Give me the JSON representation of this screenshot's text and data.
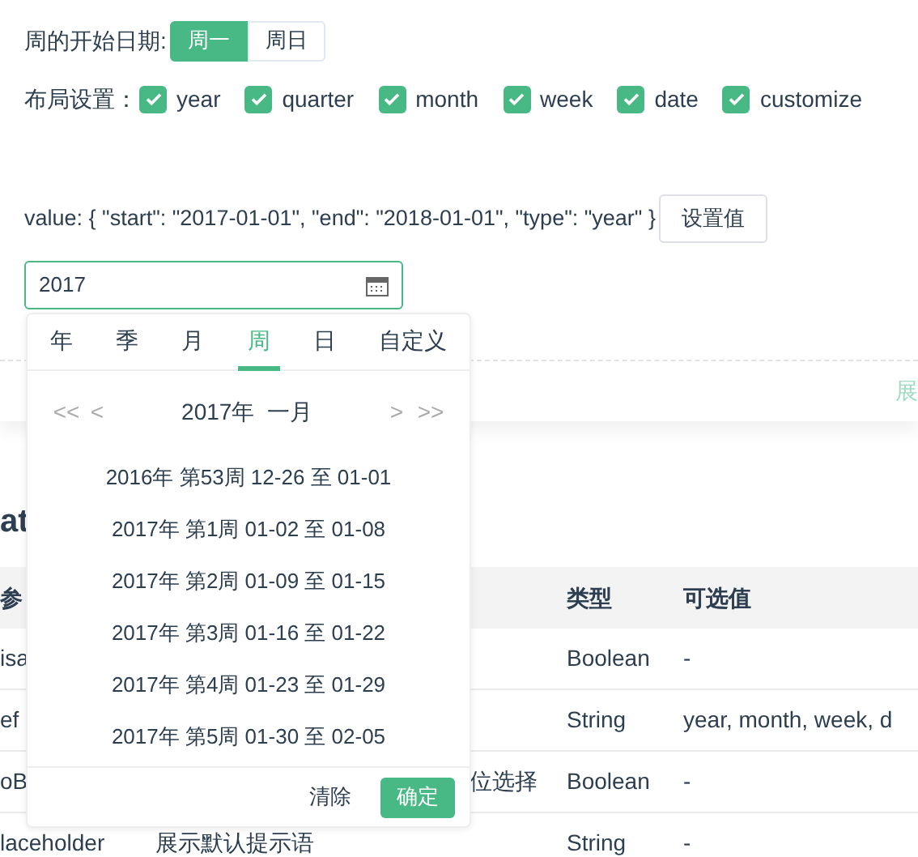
{
  "week_start": {
    "label": "周的开始日期:",
    "options": [
      {
        "label": "周一",
        "selected": true
      },
      {
        "label": "周日",
        "selected": false
      }
    ]
  },
  "layout": {
    "label": "布局设置：",
    "options": [
      {
        "label": "year",
        "checked": true
      },
      {
        "label": "quarter",
        "checked": true
      },
      {
        "label": "month",
        "checked": true
      },
      {
        "label": "week",
        "checked": true
      },
      {
        "label": "date",
        "checked": true
      },
      {
        "label": "customize",
        "checked": true
      }
    ]
  },
  "value_text": "value: { \"start\": \"2017-01-01\", \"end\": \"2018-01-01\", \"type\": \"year\" }",
  "set_button": "设置值",
  "date_input": {
    "value": "2017"
  },
  "expand_link": "展",
  "section_heading": "at",
  "table": {
    "columns": [
      "参",
      "",
      "类型",
      "可选值"
    ],
    "rows": [
      [
        "isa",
        "",
        "Boolean",
        "-"
      ],
      [
        "ef",
        "",
        "String",
        "year, month, week, d"
      ],
      [
        "oB",
        "位选择",
        "Boolean",
        "-"
      ],
      [
        "laceholder",
        "展示默认提示语",
        "String",
        "-"
      ]
    ]
  },
  "picker": {
    "tabs": [
      {
        "label": "年",
        "selected": false
      },
      {
        "label": "季",
        "selected": false
      },
      {
        "label": "月",
        "selected": false
      },
      {
        "label": "周",
        "selected": true
      },
      {
        "label": "日",
        "selected": false
      },
      {
        "label": "自定义",
        "selected": false
      }
    ],
    "nav": {
      "first": "<<",
      "prev": "<",
      "title": "2017年  一月",
      "next": ">",
      "last": ">>"
    },
    "weeks": [
      "2016年 第53周 12-26 至 01-01",
      "2017年 第1周 01-02 至 01-08",
      "2017年 第2周 01-09 至 01-15",
      "2017年 第3周 01-16 至 01-22",
      "2017年 第4周 01-23 至 01-29",
      "2017年 第5周 01-30 至 02-05"
    ],
    "clear": "清除",
    "confirm": "确定"
  }
}
